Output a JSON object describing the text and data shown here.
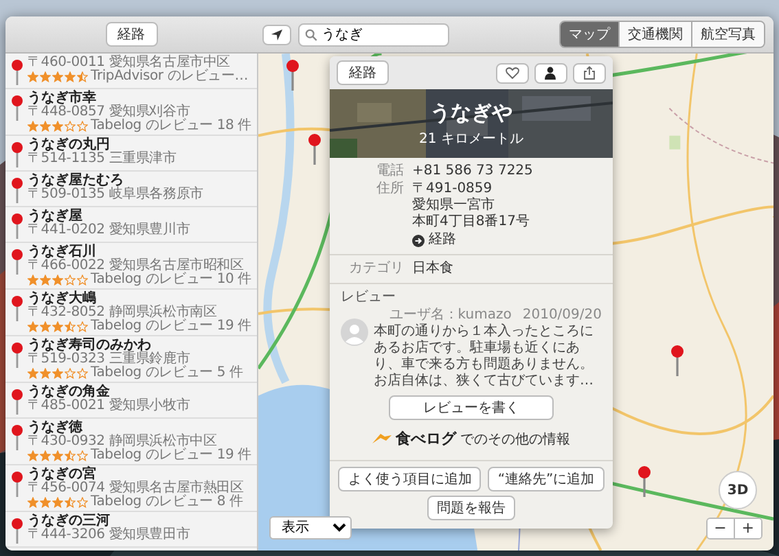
{
  "sidebar": {
    "directions_button": "経路",
    "results": [
      {
        "address": "〒460-0011 愛知県名古屋市中区",
        "stars": 4.5,
        "review": "TripAdvisor のレビュー…"
      },
      {
        "name": "うなぎ市幸",
        "address": "〒448-0857 愛知県刈谷市",
        "stars": 3,
        "review": "Tabelog のレビュー 18 件"
      },
      {
        "name": "うなぎの丸円",
        "address": "〒514-1135 三重県津市"
      },
      {
        "name": "うなぎ屋たむろ",
        "address": "〒509-0135 岐阜県各務原市"
      },
      {
        "name": "うなぎ屋",
        "address": "〒441-0202 愛知県豊川市"
      },
      {
        "name": "うなぎ石川",
        "address": "〒466-0022 愛知県名古屋市昭和区",
        "stars": 3,
        "review": "Tabelog のレビュー 10 件"
      },
      {
        "name": "うなぎ大嶋",
        "address": "〒432-8052 静岡県浜松市南区",
        "stars": 3.5,
        "review": "Tabelog のレビュー 19 件"
      },
      {
        "name": "うなぎ寿司のみかわ",
        "address": "〒519-0323 三重県鈴鹿市",
        "stars": 3,
        "review": "Tabelog のレビュー 5 件"
      },
      {
        "name": "うなぎの角金",
        "address": "〒485-0021 愛知県小牧市"
      },
      {
        "name": "うなぎ徳",
        "address": "〒430-0932 静岡県浜松市中区",
        "stars": 3.5,
        "review": "Tabelog のレビュー 19 件"
      },
      {
        "name": "うなぎの宮",
        "address": "〒456-0074 愛知県名古屋市熱田区",
        "stars": 3.5,
        "review": "Tabelog のレビュー 8 件"
      },
      {
        "name": "うなぎの三河",
        "address": "〒444-3206 愛知県豊田市"
      }
    ]
  },
  "toolbar": {
    "search": {
      "value": "うなぎ"
    },
    "map_modes": [
      {
        "label": "マップ",
        "selected": true
      },
      {
        "label": "交通機関",
        "selected": false
      },
      {
        "label": "航空写真",
        "selected": false
      }
    ]
  },
  "place_card": {
    "directions_button": "経路",
    "name": "うなぎや",
    "distance": "21 キロメートル",
    "details": [
      {
        "label": "電話",
        "lines": [
          "+81 586 73 7225"
        ]
      },
      {
        "label": "住所",
        "lines": [
          "〒491-0859",
          "愛知県一宮市",
          "本町4丁目8番17号"
        ]
      }
    ],
    "directions_link": "経路",
    "category": {
      "label": "カテゴリ",
      "value": "日本食"
    },
    "reviews_heading": "レビュー",
    "review": {
      "user": "ユーザ名：kumazo",
      "date": "2010/09/20",
      "text": "本町の通りから１本入ったところにあるお店です。駐車場も近くにあり、車で来る方も問題ありません。お店自体は、狭くて古びています…"
    },
    "write_review_button": "レビューを書く",
    "provider": {
      "logo": "食べログ",
      "text": "でのその他の情報"
    },
    "actions": [
      "よく使う項目に追加",
      "“連絡先”に追加",
      "問題を報告"
    ]
  },
  "map_controls": {
    "show_menu": "表示",
    "compass": "3D",
    "zoom_out": "−",
    "zoom_in": "+"
  }
}
